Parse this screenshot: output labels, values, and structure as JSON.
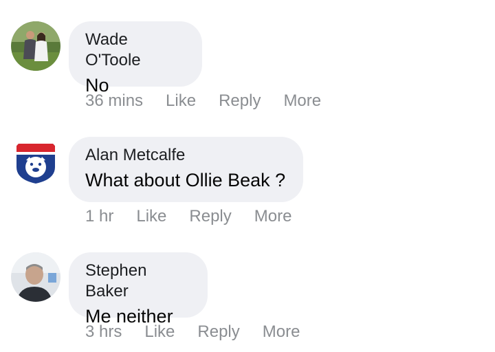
{
  "comments": [
    {
      "author": "Wade O'Toole",
      "text": "No",
      "time": "36 mins",
      "like_label": "Like",
      "reply_label": "Reply",
      "more_label": "More",
      "avatar_icon": "couple-photo-avatar"
    },
    {
      "author": "Alan Metcalfe",
      "text": "What about Ollie Beak ?",
      "time": "1 hr",
      "like_label": "Like",
      "reply_label": "Reply",
      "more_label": "More",
      "avatar_icon": "bulldog-logo-avatar"
    },
    {
      "author": "Stephen Baker",
      "text": "Me neither",
      "time": "3 hrs",
      "like_label": "Like",
      "reply_label": "Reply",
      "more_label": "More",
      "avatar_icon": "man-photo-avatar"
    }
  ],
  "colors": {
    "bubble": "#eff0f4",
    "meta_text": "#8a8d91",
    "body_text": "#050505"
  }
}
